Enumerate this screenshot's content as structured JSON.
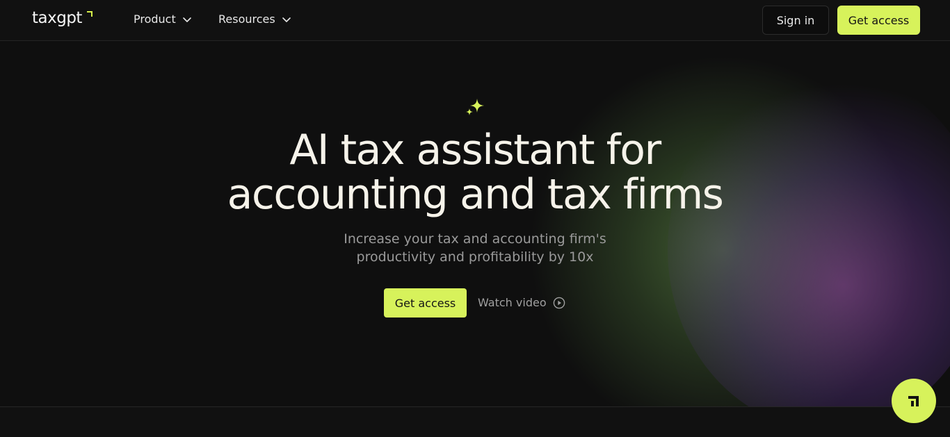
{
  "brand": {
    "name": "taxgpt"
  },
  "nav": {
    "items": [
      {
        "label": "Product"
      },
      {
        "label": "Resources"
      }
    ],
    "signin_label": "Sign in",
    "get_access_label": "Get access"
  },
  "hero": {
    "headline_line1": "AI tax assistant for",
    "headline_line2": "accounting and tax firms",
    "sub_line1": "Increase your tax and accounting firm's",
    "sub_line2": "productivity and profitability by 10x",
    "cta_label": "Get access",
    "watch_label": "Watch video"
  },
  "colors": {
    "accent": "#d7f25b",
    "background": "#0f0f0f"
  },
  "icons": {
    "sparkle": "sparkle-icon",
    "chevron": "chevron-down-icon",
    "play": "play-circle-icon",
    "chat": "chat-widget-icon"
  }
}
